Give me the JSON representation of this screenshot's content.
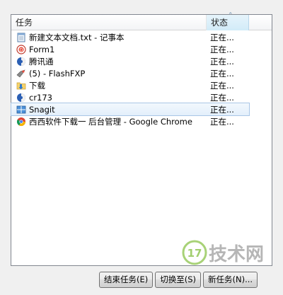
{
  "columns": {
    "task": "任务",
    "status": "状态"
  },
  "rows": [
    {
      "name": "新建文本文档.txt - 记事本",
      "status": "正在...",
      "icon": "notepad-icon"
    },
    {
      "name": "Form1",
      "status": "正在...",
      "icon": "form-app-icon"
    },
    {
      "name": "腾讯通",
      "status": "正在...",
      "icon": "rtx-icon"
    },
    {
      "name": "(5) - FlashFXP",
      "status": "正在...",
      "icon": "flashfxp-icon"
    },
    {
      "name": "下载",
      "status": "正在...",
      "icon": "folder-download-icon"
    },
    {
      "name": "cr173",
      "status": "正在...",
      "icon": "ie-app-icon"
    },
    {
      "name": "Snagit",
      "status": "正在...",
      "icon": "snagit-icon",
      "selected": true
    },
    {
      "name": "西西软件下载一 后台管理 - Google Chrome",
      "status": "正在...",
      "icon": "chrome-icon"
    }
  ],
  "buttons": {
    "end_task": "结束任务(E)",
    "switch_to": "切换至(S)",
    "new_task": "新任务(N)..."
  },
  "watermark": {
    "number": "17",
    "text": "技术网"
  },
  "colors": {
    "selection_border": "#a9c6e6",
    "header_sorted": "#d2ebf8",
    "watermark_green": "#8bc34a"
  }
}
